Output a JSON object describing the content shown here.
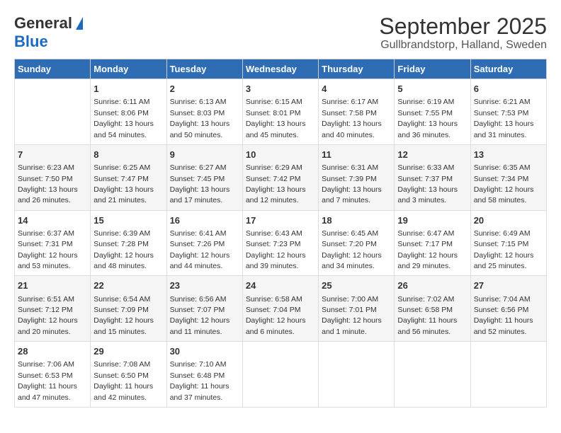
{
  "header": {
    "logo_general": "General",
    "logo_blue": "Blue",
    "title": "September 2025",
    "subtitle": "Gullbrandstorp, Halland, Sweden"
  },
  "weekdays": [
    "Sunday",
    "Monday",
    "Tuesday",
    "Wednesday",
    "Thursday",
    "Friday",
    "Saturday"
  ],
  "weeks": [
    [
      {
        "day": "",
        "info": ""
      },
      {
        "day": "1",
        "info": "Sunrise: 6:11 AM\nSunset: 8:06 PM\nDaylight: 13 hours\nand 54 minutes."
      },
      {
        "day": "2",
        "info": "Sunrise: 6:13 AM\nSunset: 8:03 PM\nDaylight: 13 hours\nand 50 minutes."
      },
      {
        "day": "3",
        "info": "Sunrise: 6:15 AM\nSunset: 8:01 PM\nDaylight: 13 hours\nand 45 minutes."
      },
      {
        "day": "4",
        "info": "Sunrise: 6:17 AM\nSunset: 7:58 PM\nDaylight: 13 hours\nand 40 minutes."
      },
      {
        "day": "5",
        "info": "Sunrise: 6:19 AM\nSunset: 7:55 PM\nDaylight: 13 hours\nand 36 minutes."
      },
      {
        "day": "6",
        "info": "Sunrise: 6:21 AM\nSunset: 7:53 PM\nDaylight: 13 hours\nand 31 minutes."
      }
    ],
    [
      {
        "day": "7",
        "info": "Sunrise: 6:23 AM\nSunset: 7:50 PM\nDaylight: 13 hours\nand 26 minutes."
      },
      {
        "day": "8",
        "info": "Sunrise: 6:25 AM\nSunset: 7:47 PM\nDaylight: 13 hours\nand 21 minutes."
      },
      {
        "day": "9",
        "info": "Sunrise: 6:27 AM\nSunset: 7:45 PM\nDaylight: 13 hours\nand 17 minutes."
      },
      {
        "day": "10",
        "info": "Sunrise: 6:29 AM\nSunset: 7:42 PM\nDaylight: 13 hours\nand 12 minutes."
      },
      {
        "day": "11",
        "info": "Sunrise: 6:31 AM\nSunset: 7:39 PM\nDaylight: 13 hours\nand 7 minutes."
      },
      {
        "day": "12",
        "info": "Sunrise: 6:33 AM\nSunset: 7:37 PM\nDaylight: 13 hours\nand 3 minutes."
      },
      {
        "day": "13",
        "info": "Sunrise: 6:35 AM\nSunset: 7:34 PM\nDaylight: 12 hours\nand 58 minutes."
      }
    ],
    [
      {
        "day": "14",
        "info": "Sunrise: 6:37 AM\nSunset: 7:31 PM\nDaylight: 12 hours\nand 53 minutes."
      },
      {
        "day": "15",
        "info": "Sunrise: 6:39 AM\nSunset: 7:28 PM\nDaylight: 12 hours\nand 48 minutes."
      },
      {
        "day": "16",
        "info": "Sunrise: 6:41 AM\nSunset: 7:26 PM\nDaylight: 12 hours\nand 44 minutes."
      },
      {
        "day": "17",
        "info": "Sunrise: 6:43 AM\nSunset: 7:23 PM\nDaylight: 12 hours\nand 39 minutes."
      },
      {
        "day": "18",
        "info": "Sunrise: 6:45 AM\nSunset: 7:20 PM\nDaylight: 12 hours\nand 34 minutes."
      },
      {
        "day": "19",
        "info": "Sunrise: 6:47 AM\nSunset: 7:17 PM\nDaylight: 12 hours\nand 29 minutes."
      },
      {
        "day": "20",
        "info": "Sunrise: 6:49 AM\nSunset: 7:15 PM\nDaylight: 12 hours\nand 25 minutes."
      }
    ],
    [
      {
        "day": "21",
        "info": "Sunrise: 6:51 AM\nSunset: 7:12 PM\nDaylight: 12 hours\nand 20 minutes."
      },
      {
        "day": "22",
        "info": "Sunrise: 6:54 AM\nSunset: 7:09 PM\nDaylight: 12 hours\nand 15 minutes."
      },
      {
        "day": "23",
        "info": "Sunrise: 6:56 AM\nSunset: 7:07 PM\nDaylight: 12 hours\nand 11 minutes."
      },
      {
        "day": "24",
        "info": "Sunrise: 6:58 AM\nSunset: 7:04 PM\nDaylight: 12 hours\nand 6 minutes."
      },
      {
        "day": "25",
        "info": "Sunrise: 7:00 AM\nSunset: 7:01 PM\nDaylight: 12 hours\nand 1 minute."
      },
      {
        "day": "26",
        "info": "Sunrise: 7:02 AM\nSunset: 6:58 PM\nDaylight: 11 hours\nand 56 minutes."
      },
      {
        "day": "27",
        "info": "Sunrise: 7:04 AM\nSunset: 6:56 PM\nDaylight: 11 hours\nand 52 minutes."
      }
    ],
    [
      {
        "day": "28",
        "info": "Sunrise: 7:06 AM\nSunset: 6:53 PM\nDaylight: 11 hours\nand 47 minutes."
      },
      {
        "day": "29",
        "info": "Sunrise: 7:08 AM\nSunset: 6:50 PM\nDaylight: 11 hours\nand 42 minutes."
      },
      {
        "day": "30",
        "info": "Sunrise: 7:10 AM\nSunset: 6:48 PM\nDaylight: 11 hours\nand 37 minutes."
      },
      {
        "day": "",
        "info": ""
      },
      {
        "day": "",
        "info": ""
      },
      {
        "day": "",
        "info": ""
      },
      {
        "day": "",
        "info": ""
      }
    ]
  ]
}
